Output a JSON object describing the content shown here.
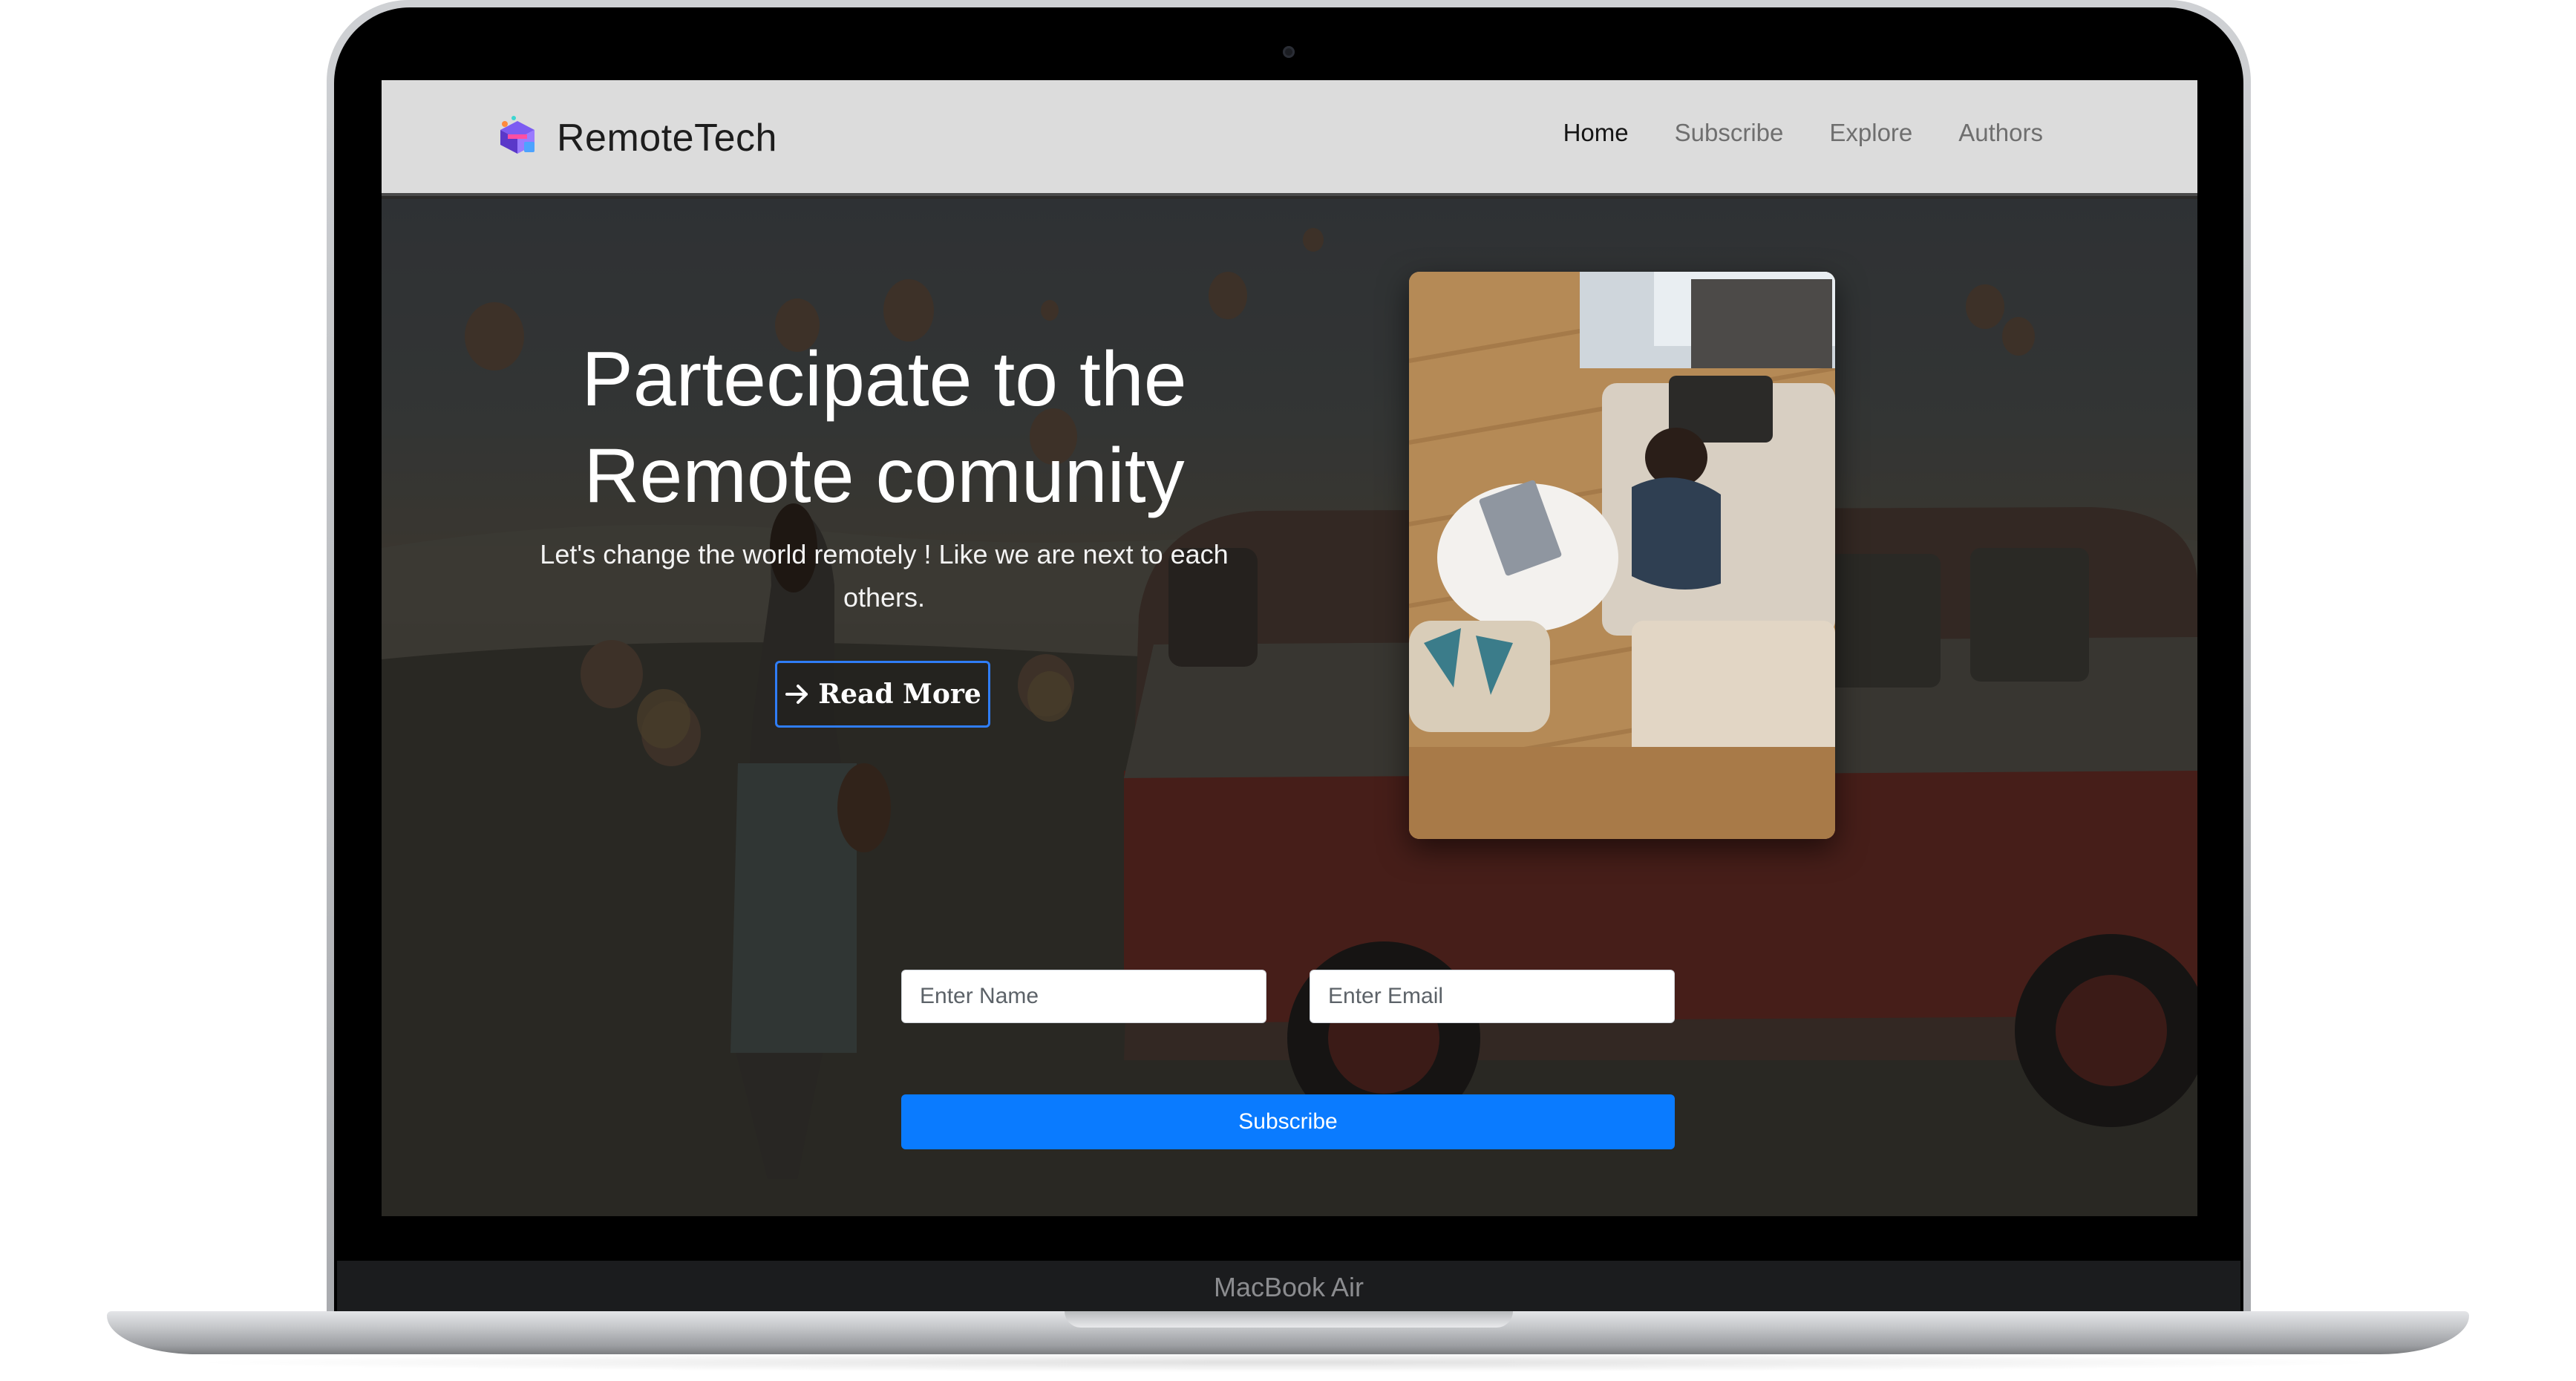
{
  "device": {
    "model_label": "MacBook Air"
  },
  "navbar": {
    "brand": "RemoteTech",
    "links": [
      {
        "label": "Home",
        "active": true
      },
      {
        "label": "Subscribe",
        "active": false
      },
      {
        "label": "Explore",
        "active": false
      },
      {
        "label": "Authors",
        "active": false
      }
    ]
  },
  "hero": {
    "title_line1": "Partecipate to the",
    "title_line2": "Remote comunity",
    "subtitle": "Let's change the world remotely ! Like we are next to each others.",
    "read_more_label": "Read More",
    "read_more_icon": "arrow-right-icon",
    "background_image": "hot-air-balloons-and-red-van-photo",
    "feature_image": "person-working-on-laptop-photo"
  },
  "subscribe_form": {
    "name_placeholder": "Enter Name",
    "email_placeholder": "Enter Email",
    "submit_label": "Subscribe"
  },
  "colors": {
    "navbar_background": "#dcdcdc",
    "accent_blue": "#0a7bff",
    "read_more_border": "#2f7df6",
    "hero_text": "#ffffff"
  }
}
